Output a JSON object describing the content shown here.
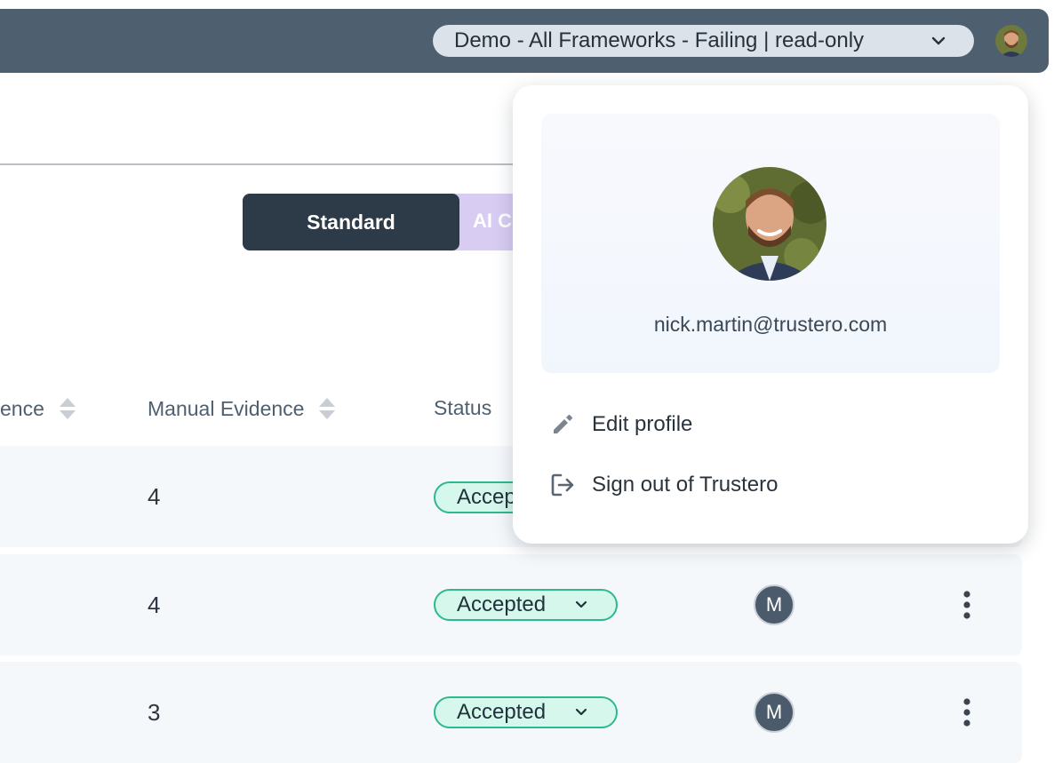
{
  "header": {
    "environment_label": "Demo - All Frameworks - Failing | read-only",
    "icons": {
      "dropdown": "chevron-down-icon",
      "user": "avatar"
    }
  },
  "view_toggle": {
    "standard_label": "Standard",
    "ai_label": "AI C"
  },
  "table": {
    "columns": {
      "auto_evidence_label": "ence",
      "manual_evidence_label": "Manual Evidence",
      "status_label": "Status"
    },
    "rows": [
      {
        "manual_evidence": "4",
        "status": "Accep"
      },
      {
        "manual_evidence": "4",
        "status": "Accepted",
        "owner_initial": "M"
      },
      {
        "manual_evidence": "3",
        "status": "Accepted",
        "owner_initial": "M"
      }
    ]
  },
  "user_menu": {
    "email": "nick.martin@trustero.com",
    "items": [
      {
        "label": "Edit profile",
        "icon": "pencil-icon"
      },
      {
        "label": "Sign out of Trustero",
        "icon": "sign-out-icon"
      }
    ]
  },
  "colors": {
    "topbar": "#4e5f6f",
    "accent_status": "#2db88d",
    "standard_toggle": "#2d3a47",
    "ai_toggle": "#d8ccf2"
  }
}
